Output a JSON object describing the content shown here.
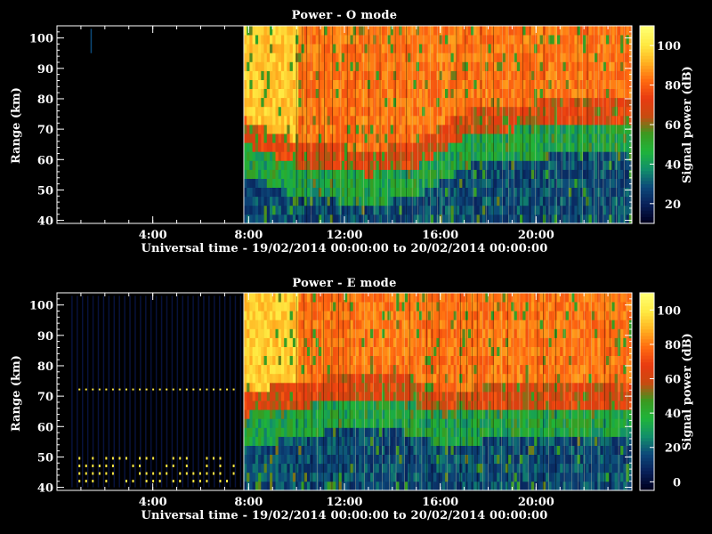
{
  "colors": {
    "background": "#000000",
    "axes": "#ffffff",
    "colormap": [
      "#000020",
      "#08205a",
      "#0d4a7a",
      "#12906a",
      "#1fb43a",
      "#3a9a20",
      "#c94a10",
      "#e83a10",
      "#ff6a10",
      "#ffb020",
      "#ffe840",
      "#ffff70"
    ]
  },
  "chart_data": [
    {
      "type": "heatmap",
      "title": "Power - O mode",
      "xlabel": "Universal time - 19/02/2014 00:00:00 to 20/02/2014 00:00:00",
      "ylabel": "Range (km)",
      "colorbar_label": "Signal power (dB)",
      "x_ticks": [
        "4:00",
        "8:00",
        "12:00",
        "16:00",
        "20:00"
      ],
      "x_tick_hours": [
        4,
        8,
        12,
        16,
        20
      ],
      "xlim_hours": [
        0,
        24
      ],
      "y_ticks": [
        40,
        50,
        60,
        70,
        80,
        90,
        100
      ],
      "ylim": [
        39,
        104
      ],
      "colorbar_ticks": [
        20,
        40,
        60,
        80,
        100
      ],
      "colorbar_range": [
        10,
        110
      ],
      "night_end_hour": 7.8,
      "signal_boundary_km": [
        {
          "hour": 7.8,
          "km": 65
        },
        {
          "hour": 10,
          "km": 58
        },
        {
          "hour": 13,
          "km": 55
        },
        {
          "hour": 15,
          "km": 58
        },
        {
          "hour": 17,
          "km": 68
        },
        {
          "hour": 20,
          "km": 71
        },
        {
          "hour": 24,
          "km": 73
        }
      ]
    },
    {
      "type": "heatmap",
      "title": "Power - E mode",
      "xlabel": "Universal time - 19/02/2014 00:00:00 to 20/02/2014 00:00:00",
      "ylabel": "Range (km)",
      "colorbar_label": "Signal power (dB)",
      "x_ticks": [
        "4:00",
        "8:00",
        "12:00",
        "16:00",
        "20:00"
      ],
      "x_tick_hours": [
        4,
        8,
        12,
        16,
        20
      ],
      "xlim_hours": [
        0,
        24
      ],
      "y_ticks": [
        40,
        50,
        60,
        70,
        80,
        90,
        100
      ],
      "ylim": [
        39,
        104
      ],
      "colorbar_ticks": [
        0,
        20,
        40,
        60,
        80,
        100
      ],
      "colorbar_range": [
        -5,
        110
      ],
      "night_end_hour": 7.8,
      "signal_boundary_km": [
        {
          "hour": 7.8,
          "km": 64
        },
        {
          "hour": 10,
          "km": 66
        },
        {
          "hour": 12,
          "km": 70
        },
        {
          "hour": 14,
          "km": 70
        },
        {
          "hour": 16,
          "km": 64
        },
        {
          "hour": 20,
          "km": 67
        },
        {
          "hour": 24,
          "km": 67
        }
      ]
    }
  ]
}
